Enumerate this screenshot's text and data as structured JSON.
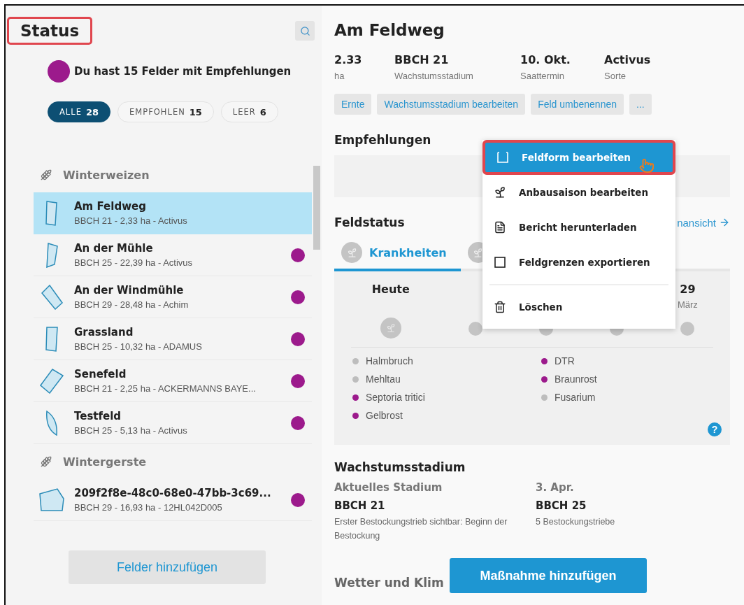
{
  "sidebar": {
    "title": "Status",
    "summary": {
      "text": "Du hast 15 Felder mit Empfehlungen",
      "color": "#9c1a8c"
    },
    "filters": [
      {
        "label": "ALLE",
        "count": "28",
        "selected": true
      },
      {
        "label": "EMPFOHLEN",
        "count": "15",
        "selected": false
      },
      {
        "label": "LEER",
        "count": "6",
        "selected": false
      }
    ],
    "groups": [
      {
        "crop": "Winterweizen",
        "fields": [
          {
            "name": "Am Feldweg",
            "details": "BBCH 21 - 2,33 ha - Activus",
            "selected": true,
            "recommended": false
          },
          {
            "name": "An der Mühle",
            "details": "BBCH 25 - 22,39 ha - Activus",
            "selected": false,
            "recommended": true
          },
          {
            "name": "An der Windmühle",
            "details": "BBCH 29 - 28,48 ha - Achim",
            "selected": false,
            "recommended": true
          },
          {
            "name": "Grassland",
            "details": "BBCH 25 - 10,32 ha - ADAMUS",
            "selected": false,
            "recommended": true
          },
          {
            "name": "Senefeld",
            "details": "BBCH 21 - 2,25 ha - ACKERMANNS BAYE...",
            "selected": false,
            "recommended": true
          },
          {
            "name": "Testfeld",
            "details": "BBCH 25 - 5,13 ha - Activus",
            "selected": false,
            "recommended": true
          }
        ]
      },
      {
        "crop": "Wintergerste",
        "fields": [
          {
            "name": "209f2f8e-48c0-68e0-47bb-3c69...",
            "details": "BBCH 29 - 16,93 ha - 12HL042D005",
            "selected": false,
            "recommended": true
          }
        ]
      }
    ],
    "add_button": "Felder hinzufügen"
  },
  "detail": {
    "title": "Am Feldweg",
    "stats": [
      {
        "value": "2.33",
        "label": "ha"
      },
      {
        "value": "BBCH 21",
        "label": "Wachstumsstadium"
      },
      {
        "value": "10. Okt.",
        "label": "Saattermin"
      },
      {
        "value": "Activus",
        "label": "Sorte"
      }
    ],
    "actions": [
      "Ernte",
      "Wachstumsstadium bearbeiten",
      "Feld umbenennen",
      "..."
    ],
    "recommendations_title": "Empfehlungen",
    "status_title": "Feldstatus",
    "status_link": "nansicht",
    "tabs": [
      {
        "label": "Krankheiten",
        "selected": true
      },
      {
        "selected": false
      }
    ],
    "timeline": [
      {
        "day": "Heute",
        "current": true
      },
      {
        "current": false
      },
      {
        "current": false
      },
      {
        "current": false
      },
      {
        "day": "29",
        "month": "März",
        "current": false
      }
    ],
    "diseases": [
      {
        "name": "Halmbruch",
        "color": "#bdbdbd"
      },
      {
        "name": "Mehltau",
        "color": "#bdbdbd"
      },
      {
        "name": "Septoria tritici",
        "color": "#9c1a8c"
      },
      {
        "name": "Gelbrost",
        "color": "#9c1a8c"
      },
      {
        "name": "DTR",
        "color": "#9c1a8c"
      },
      {
        "name": "Braunrost",
        "color": "#9c1a8c"
      },
      {
        "name": "Fusarium",
        "color": "#bdbdbd"
      }
    ],
    "help": "?",
    "growth": {
      "title": "Wachstumsstadium",
      "columns": [
        {
          "heading": "Aktuelles Stadium",
          "stage": "BBCH 21",
          "description": "Erster Bestockungstrieb sichtbar: Beginn der Bestockung"
        },
        {
          "heading": "3. Apr.",
          "stage": "BBCH 25",
          "description": "5 Bestockungstriebe"
        }
      ]
    },
    "weather_title": "Wetter und Klim",
    "primary_button": "Maßnahme hinzufügen"
  },
  "menu": [
    {
      "label": "Feldform bearbeiten",
      "kind": "shape",
      "selected": true
    },
    {
      "label": "Anbausaison bearbeiten",
      "kind": "sprout",
      "selected": false
    },
    {
      "label": "Bericht herunterladen",
      "kind": "report",
      "selected": false
    },
    {
      "label": "Feldgrenzen exportieren",
      "kind": "bounds",
      "selected": false
    },
    {
      "label": "Löschen",
      "kind": "trash",
      "selected": false,
      "separated": true
    }
  ]
}
